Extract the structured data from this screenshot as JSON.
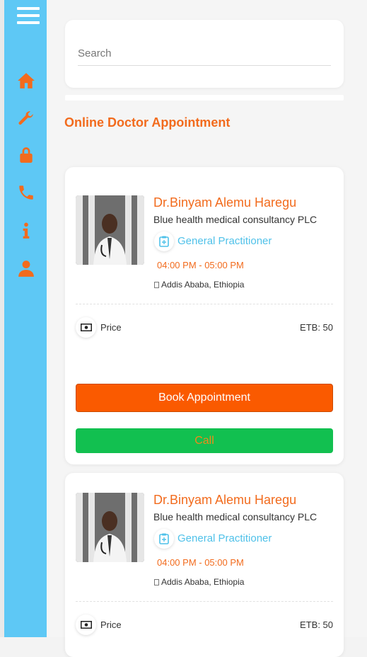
{
  "search": {
    "placeholder": "Search"
  },
  "section_title": "Online Doctor Appointment",
  "sidebar": {
    "items": [
      {
        "icon": "home-icon"
      },
      {
        "icon": "wrench-icon"
      },
      {
        "icon": "lock-icon"
      },
      {
        "icon": "phone-icon"
      },
      {
        "icon": "info-icon"
      },
      {
        "icon": "user-icon"
      }
    ]
  },
  "doctors": [
    {
      "name": "Dr.Binyam Alemu Haregu",
      "organization": "Blue health medical consultancy PLC",
      "specialty": "General Practitioner",
      "time": "04:00 PM - 05:00 PM",
      "location": "Addis Ababa, Ethiopia",
      "price_label": "Price",
      "price_value": "ETB: 50",
      "book_label": "Book Appointment",
      "call_label": "Call"
    },
    {
      "name": "Dr.Binyam Alemu Haregu",
      "organization": "Blue health medical consultancy PLC",
      "specialty": "General Practitioner",
      "time": "04:00 PM - 05:00 PM",
      "location": "Addis Ababa, Ethiopia",
      "price_label": "Price",
      "price_value": "ETB: 50"
    }
  ],
  "colors": {
    "sidebar": "#5ec8f5",
    "accent_orange": "#f26b1d",
    "book_button": "#fa5a00",
    "call_button": "#12c050",
    "specialty": "#4fc1e9"
  }
}
